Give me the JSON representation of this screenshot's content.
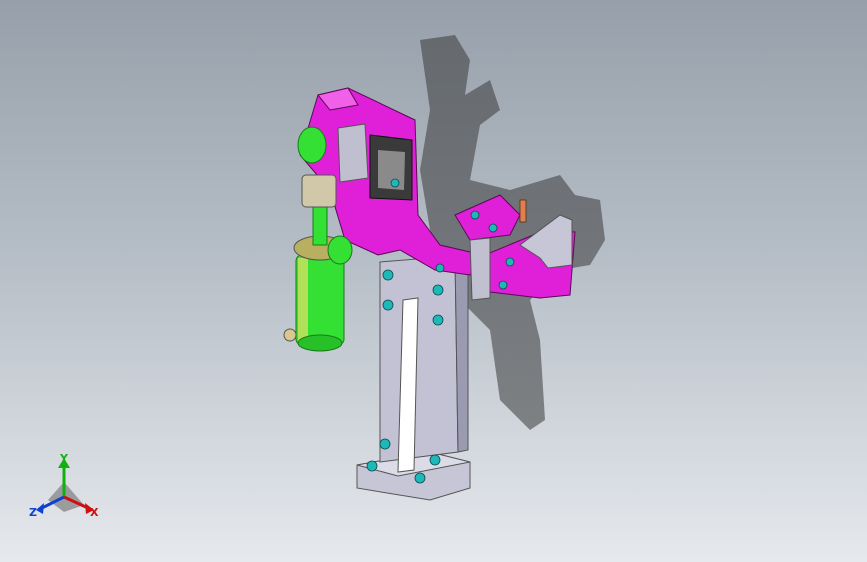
{
  "colors": {
    "bg_top": "#97a0aa",
    "bg_bottom": "#e6e9ed",
    "clamp_arm": "#e020d8",
    "cylinder": "#33e033",
    "base_plate": "#c8c8d8",
    "fastener": "#1fb8b8",
    "shadow": "#3a3a3a",
    "axis_x": "#d01010",
    "axis_y": "#10b010",
    "axis_z": "#1040d0"
  },
  "triad": {
    "x_label": "X",
    "y_label": "Y",
    "z_label": "Z"
  }
}
